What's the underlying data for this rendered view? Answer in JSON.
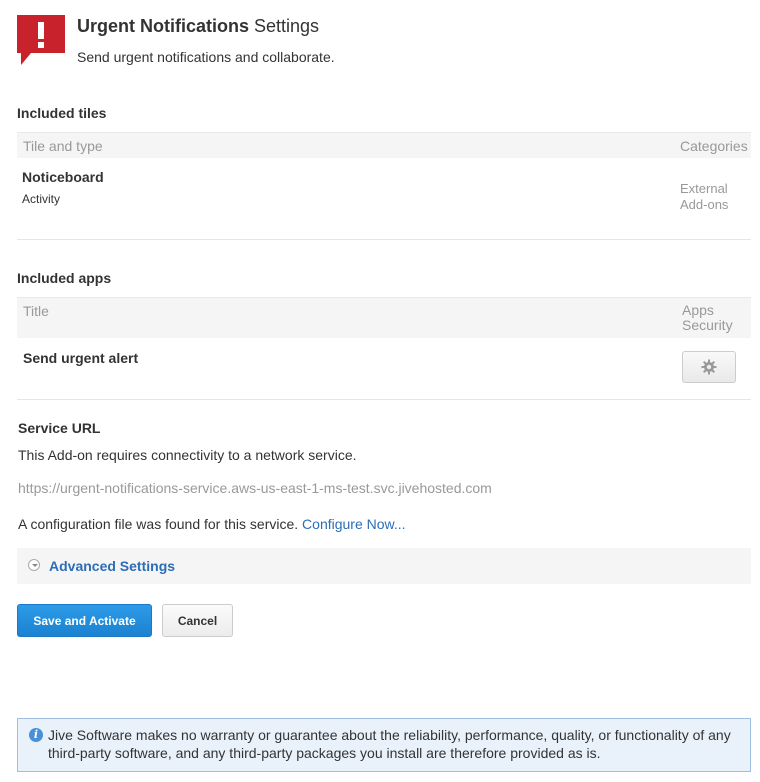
{
  "header": {
    "title_bold": "Urgent Notifications",
    "title_rest": " Settings",
    "subtitle": "Send urgent notifications and collaborate.",
    "icon": "alert-bubble-icon",
    "icon_color": "#c8232c"
  },
  "tiles": {
    "heading": "Included tiles",
    "columns": [
      "Tile and type",
      "Categories"
    ],
    "rows": [
      {
        "name": "Noticeboard",
        "type": "Activity",
        "category_1": "External",
        "category_2": "Add-ons"
      }
    ]
  },
  "apps": {
    "heading": "Included apps",
    "col_title": "Title",
    "col_security_1": "Apps",
    "col_security_2": "Security",
    "rows": [
      {
        "name": "Send urgent alert",
        "security_icon": "gear-icon"
      }
    ]
  },
  "service": {
    "heading": "Service URL",
    "description": "This Add-on requires connectivity to a network service.",
    "url": "https://urgent-notifications-service.aws-us-east-1-ms-test.svc.jivehosted.com",
    "config_text": "A configuration file was found for this service. ",
    "config_link": "Configure Now..."
  },
  "advanced": {
    "label": "Advanced Settings"
  },
  "buttons": {
    "save": "Save and Activate",
    "cancel": "Cancel",
    "primary_color": "#1b82d0"
  },
  "disclaimer": {
    "icon": "info-icon",
    "text": "Jive Software makes no warranty or guarantee about the reliability, performance, quality, or functionality of any third-party software, and any third-party packages you install are therefore provided as is."
  }
}
